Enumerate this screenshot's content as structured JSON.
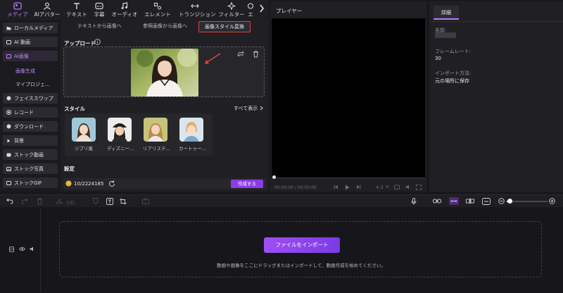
{
  "toolbar": {
    "items": [
      {
        "label": "メディア",
        "icon": "media-icon"
      },
      {
        "label": "AIアバター",
        "icon": "avatar-icon"
      },
      {
        "label": "テキスト",
        "icon": "text-icon"
      },
      {
        "label": "字幕",
        "icon": "subtitle-icon"
      },
      {
        "label": "オーディオ",
        "icon": "audio-icon"
      },
      {
        "label": "エレメント",
        "icon": "element-icon"
      },
      {
        "label": "トランジション",
        "icon": "transition-icon"
      },
      {
        "label": "フィルター",
        "icon": "filter-icon"
      },
      {
        "label": "エ",
        "icon": "effect-icon"
      }
    ],
    "more_icon": "chevron-right-icon",
    "accent_color": "#b57cff"
  },
  "sidebar": {
    "items": [
      {
        "label": "ローカルメディア"
      },
      {
        "label": "AI 動画"
      },
      {
        "label": "AI画像"
      },
      {
        "label": "画像生成"
      },
      {
        "label": "マイプロジェ..."
      },
      {
        "label": "フェイススワップ"
      },
      {
        "label": "レコード"
      },
      {
        "label": "ダウンロード"
      },
      {
        "label": "背景"
      },
      {
        "label": "ストック動画"
      },
      {
        "label": "ストック写真"
      },
      {
        "label": "ストックGIF"
      }
    ]
  },
  "panel": {
    "tabs": [
      {
        "label": "テキストから画像へ"
      },
      {
        "label": "参照画像から画像へ"
      },
      {
        "label": "画像スタイル変換"
      }
    ],
    "upload_title": "アップロード",
    "style_title": "スタイル",
    "show_all": "すべて表示",
    "styles": [
      {
        "label": "ジブリ風"
      },
      {
        "label": "ディズニー..."
      },
      {
        "label": "リアリステ..."
      },
      {
        "label": "カートゥー..."
      }
    ],
    "settings_title": "設定",
    "credits": "10/2224185",
    "create_label": "作成する"
  },
  "player": {
    "title": "プレイヤー",
    "time": "00:00:00 / 00:00:00",
    "ratio": "4:3"
  },
  "details": {
    "tab": "詳細",
    "name_label": "名前:",
    "framerate_label": "フレームレート:",
    "framerate_value": "30",
    "import_label": "インポート方法:",
    "import_value": "元の場所に保存"
  },
  "timeline": {
    "split_label": "分割",
    "import_button": "ファイルをインポート",
    "drop_hint": "動画や画像をここにドラッグまたはインポートして、動画作成を始めてください。"
  }
}
